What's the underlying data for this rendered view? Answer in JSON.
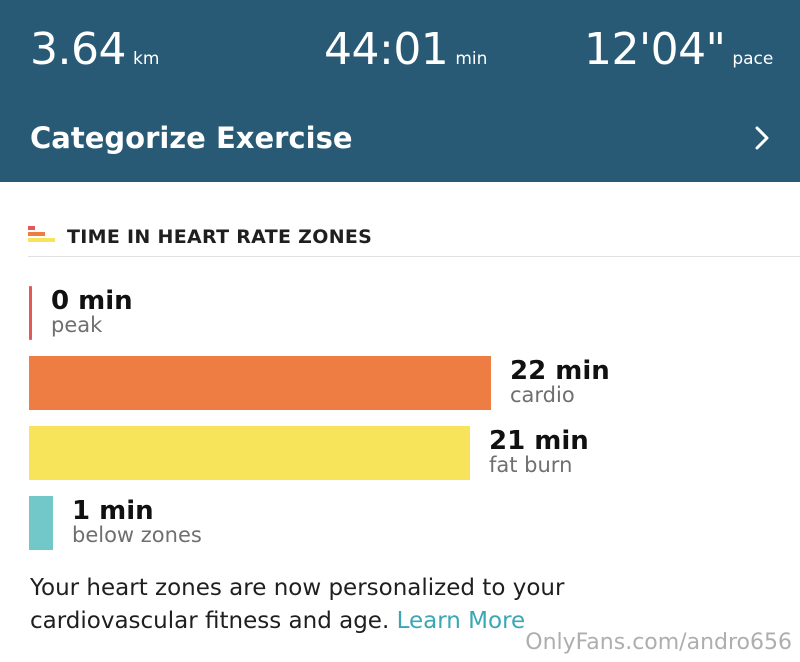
{
  "summary": {
    "distance": {
      "value": "3.64",
      "unit": "km"
    },
    "duration": {
      "value": "44:01",
      "unit": "min"
    },
    "pace": {
      "value": "12'04\"",
      "unit": "pace"
    }
  },
  "categorize": {
    "label": "Categorize Exercise"
  },
  "heart_rate_zones": {
    "title": "TIME IN HEART RATE ZONES",
    "icon": "heart-rate-zones-icon",
    "zones": [
      {
        "minutes_label": "0 min",
        "name": "peak",
        "minutes": 0,
        "color": "#e05a5a"
      },
      {
        "minutes_label": "22 min",
        "name": "cardio",
        "minutes": 22,
        "color": "#ee7d44"
      },
      {
        "minutes_label": "21 min",
        "name": "fat burn",
        "minutes": 21,
        "color": "#f7e45a"
      },
      {
        "minutes_label": "1 min",
        "name": "below zones",
        "minutes": 1,
        "color": "#72c8c8"
      }
    ]
  },
  "note": {
    "text": "Your heart zones are now personalized to your cardiovascular fitness and age.",
    "link_label": "Learn More"
  },
  "colors": {
    "header_bg": "#285a76",
    "accent_link": "#3aa7b5"
  },
  "watermark": "OnlyFans.com/andro656"
}
